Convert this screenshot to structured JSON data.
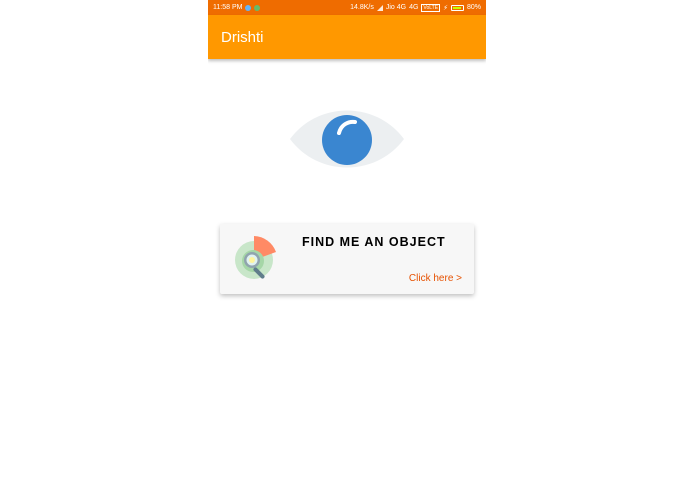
{
  "status_bar": {
    "time": "11:58 PM",
    "speed": "14.8K/s",
    "network": "Jio 4G",
    "network_type": "4G",
    "volte": "VoLTE",
    "battery": "80%",
    "icons": [
      "notification-icon",
      "notification-icon",
      "signal-icon",
      "volte-icon",
      "charging-icon",
      "battery-icon"
    ]
  },
  "app_bar": {
    "title": "Drishti"
  },
  "hero": {
    "icon": "eye-icon",
    "colors": {
      "sclera": "#eceff1",
      "iris": "#3a86d0",
      "highlight": "#ffffff"
    }
  },
  "card": {
    "title": "FIND ME AN OBJECT",
    "link": "Click here >",
    "icon": "search-object-icon",
    "link_color": "#e65100"
  },
  "colors": {
    "status_bar": "#ef6c00",
    "app_bar": "#ff9800"
  }
}
